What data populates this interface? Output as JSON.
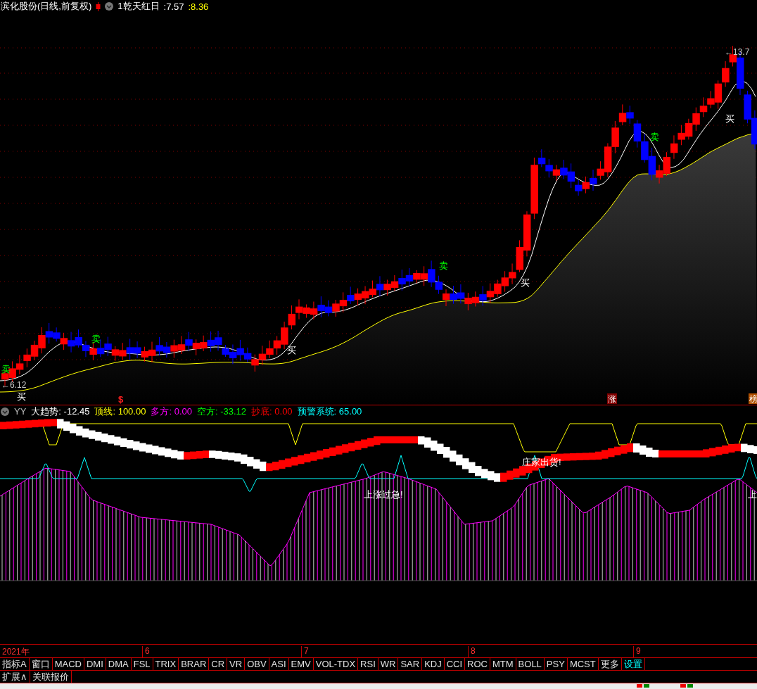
{
  "header": {
    "title": "滨化股份(日线,前复权)",
    "indicator": "1乾天红日",
    "values": [
      {
        "text": ":7.57",
        "color": "#ffffff"
      },
      {
        "text": ":8.36",
        "color": "#ffff00"
      }
    ]
  },
  "chart": {
    "signals": [
      {
        "kind": "sell",
        "text": "卖"
      },
      {
        "kind": "buy",
        "text": "买"
      },
      {
        "kind": "sell",
        "text": "卖"
      },
      {
        "kind": "buy",
        "text": "买"
      },
      {
        "kind": "sell",
        "text": "卖"
      },
      {
        "kind": "buy",
        "text": "买"
      },
      {
        "kind": "sell",
        "text": "卖"
      },
      {
        "kind": "buy",
        "text": "买"
      }
    ],
    "price_labels": [
      "←6.12",
      "←13.7"
    ],
    "events": [
      {
        "kind": "dollar",
        "text": "$"
      },
      {
        "kind": "tag",
        "text": "涨"
      },
      {
        "kind": "tag",
        "text": "榜"
      }
    ]
  },
  "indicator": {
    "name": "YY",
    "values": [
      {
        "text": "大趋势: -12.45",
        "color": "#ffffff"
      },
      {
        "text": "顶线: 100.00",
        "color": "#ffff00"
      },
      {
        "text": "多方: 0.00",
        "color": "#ff00ff"
      },
      {
        "text": "空方: -33.12",
        "color": "#00ff00"
      },
      {
        "text": "抄底: 0.00",
        "color": "#ff0000"
      },
      {
        "text": "预警系统: 65.00",
        "color": "#00ffff"
      }
    ],
    "alerts": [
      "上涨过急!",
      "庄家出货!",
      "上"
    ]
  },
  "time_axis": [
    "2021年",
    "6",
    "7",
    "8",
    "9"
  ],
  "tabs": [
    {
      "label": "指标A",
      "kind": "menu"
    },
    {
      "label": "窗口",
      "kind": "menu"
    },
    {
      "label": "MACD",
      "kind": "indicator"
    },
    {
      "label": "DMI",
      "kind": "indicator"
    },
    {
      "label": "DMA",
      "kind": "indicator"
    },
    {
      "label": "FSL",
      "kind": "indicator"
    },
    {
      "label": "TRIX",
      "kind": "indicator"
    },
    {
      "label": "BRAR",
      "kind": "indicator"
    },
    {
      "label": "CR",
      "kind": "indicator"
    },
    {
      "label": "VR",
      "kind": "indicator"
    },
    {
      "label": "OBV",
      "kind": "indicator"
    },
    {
      "label": "ASI",
      "kind": "indicator"
    },
    {
      "label": "EMV",
      "kind": "indicator"
    },
    {
      "label": "VOL-TDX",
      "kind": "indicator"
    },
    {
      "label": "RSI",
      "kind": "indicator"
    },
    {
      "label": "WR",
      "kind": "indicator"
    },
    {
      "label": "SAR",
      "kind": "indicator"
    },
    {
      "label": "KDJ",
      "kind": "indicator"
    },
    {
      "label": "CCI",
      "kind": "indicator"
    },
    {
      "label": "ROC",
      "kind": "indicator"
    },
    {
      "label": "MTM",
      "kind": "indicator"
    },
    {
      "label": "BOLL",
      "kind": "indicator"
    },
    {
      "label": "PSY",
      "kind": "indicator"
    },
    {
      "label": "MCST",
      "kind": "indicator"
    },
    {
      "label": "更多",
      "kind": "menu"
    },
    {
      "label": "设置",
      "kind": "settings"
    }
  ],
  "bottom_tabs": [
    "扩展∧",
    "关联报价"
  ]
}
